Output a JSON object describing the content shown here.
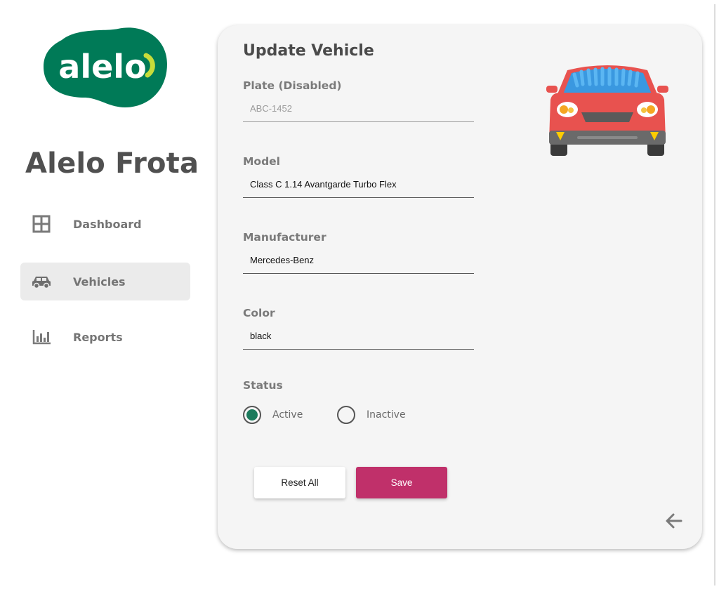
{
  "sidebar": {
    "logo_text": "alelo",
    "brand_title": "Alelo Frota",
    "items": [
      {
        "label": "Dashboard",
        "icon": "grid-icon"
      },
      {
        "label": "Vehicles",
        "icon": "car-icon",
        "active": true
      },
      {
        "label": "Reports",
        "icon": "bar-chart-icon"
      }
    ]
  },
  "form": {
    "title": "Update Vehicle",
    "plate": {
      "label": "Plate (Disabled)",
      "value": "ABC-1452"
    },
    "model": {
      "label": "Model",
      "value": "Class C 1.14 Avantgarde Turbo Flex"
    },
    "manufacturer": {
      "label": "Manufacturer",
      "value": "Mercedes-Benz"
    },
    "color": {
      "label": "Color",
      "value": "black"
    },
    "status": {
      "label": "Status",
      "options": [
        "Active",
        "Inactive"
      ],
      "selected": "Active"
    },
    "reset_label": "Reset All",
    "save_label": "Save"
  },
  "colors": {
    "brand_green": "#007a57",
    "brand_lime": "#c7dc3a",
    "save_button": "#c0306a",
    "radio_selected": "#1b7a5c",
    "car_body": "#e8524f",
    "car_windshield": "#3a98e0"
  }
}
